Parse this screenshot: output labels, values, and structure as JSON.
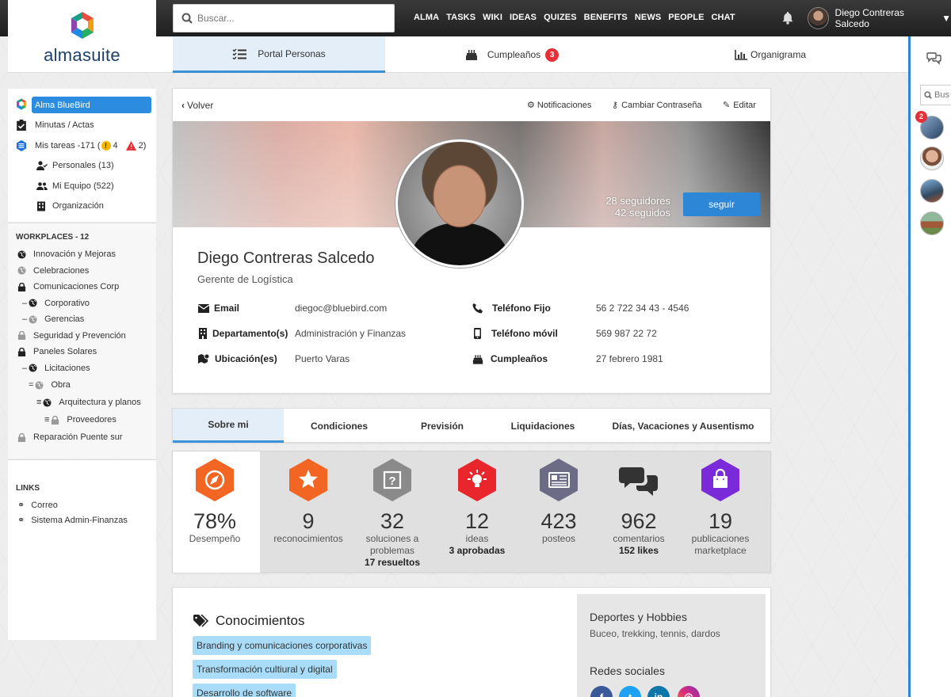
{
  "brand": {
    "logo_text": "almasuite"
  },
  "search": {
    "placeholder": "Buscar..."
  },
  "topnav": [
    "ALMA",
    "TASKS",
    "WIKI",
    "IDEAS",
    "QUIZES",
    "BENEFITS",
    "NEWS",
    "PEOPLE",
    "CHAT"
  ],
  "user": {
    "name": "Diego Contreras Salcedo"
  },
  "subnav": {
    "portal": "Portal Personas",
    "birthdays": "Cumpleaños",
    "birthdays_count": "3",
    "org": "Organigrama"
  },
  "rightbar": {
    "search_placeholder": "Bus",
    "avatar_badge": "2"
  },
  "sidebar": {
    "items": [
      {
        "label": "Alma BlueBird",
        "icon": "alma-logo-icon"
      },
      {
        "label": "Minutas / Actas",
        "icon": "clipboard-check-icon"
      },
      {
        "label_prefix": "Mis tareas -171 (",
        "warn_count": "4",
        "alert_count": "2)",
        "icon": "tasks-icon"
      },
      {
        "label": "Personales (13)",
        "icon": "user-check-icon"
      },
      {
        "label": "Mi Equipo (522)",
        "icon": "users-icon"
      },
      {
        "label": "Organización",
        "icon": "building-icon"
      }
    ],
    "workplaces_title": "WORKPLACES - 12",
    "workplaces": [
      {
        "label": "Innovación y Mejoras",
        "prefix": "",
        "icon": "globe-icon"
      },
      {
        "label": "Celebraciones",
        "prefix": "",
        "icon": "globe-gray-icon"
      },
      {
        "label": "Comunicaciones Corp",
        "prefix": "",
        "icon": "lock-icon"
      },
      {
        "label": "Corporativo",
        "prefix": "–",
        "icon": "globe-icon"
      },
      {
        "label": "Gerencias",
        "prefix": "–",
        "icon": "globe-gray-icon"
      },
      {
        "label": "Seguridad y Prevención",
        "prefix": "",
        "icon": "lock-gray-icon"
      },
      {
        "label": "Paneles Solares",
        "prefix": "",
        "icon": "lock-icon"
      },
      {
        "label": "Licitaciones",
        "prefix": "–",
        "icon": "globe-icon"
      },
      {
        "label": "Obra",
        "prefix": "=",
        "icon": "globe-gray-icon"
      },
      {
        "label": "Arquitectura y planos",
        "prefix": "≡",
        "icon": "globe-icon"
      },
      {
        "label": "Proveedores",
        "prefix": "≡",
        "icon": "lock-gray-icon"
      },
      {
        "label": "Reparación Puente sur",
        "prefix": "",
        "icon": "lock-gray-icon"
      }
    ],
    "links_title": "LINKS",
    "links": [
      "Correo",
      "Sistema Admin-Finanzas"
    ]
  },
  "profile": {
    "back": "Volver",
    "notifications": "Notificaciones",
    "change_password": "Cambiar Contraseña",
    "edit": "Editar",
    "followers": "28 seguidores",
    "following": "42 seguidos",
    "follow_button": "seguir",
    "name": "Diego Contreras Salcedo",
    "role": "Gerente de Logística",
    "fields": [
      {
        "label": "Email",
        "value": "diegoc@bluebird.com",
        "icon": "envelope-icon"
      },
      {
        "label": "Departamento(s)",
        "value": "Administración y Finanzas",
        "icon": "building-icon"
      },
      {
        "label": "Ubicación(es)",
        "value": "Puerto Varas",
        "icon": "map-icon"
      },
      {
        "label": "Teléfono Fijo",
        "value": "56 2 722 34 43 - 4546",
        "icon": "phone-icon"
      },
      {
        "label": "Teléfono móvil",
        "value": "569 987 22 72",
        "icon": "mobile-icon"
      },
      {
        "label": "Cumpleaños",
        "value": "27 febrero 1981",
        "icon": "cake-icon"
      }
    ]
  },
  "tabs": [
    "Sobre mi",
    "Condiciones",
    "Previsión",
    "Liquidaciones",
    "Días, Vacaciones y Ausentismo"
  ],
  "stats": [
    {
      "num": "78%",
      "lbl": "Desempeño",
      "lbl2": "",
      "sub": "",
      "color": "#f26522",
      "icon": "compass-icon"
    },
    {
      "num": "9",
      "lbl": "reconocimientos",
      "lbl2": "",
      "sub": "",
      "color": "#f26522",
      "icon": "star-icon"
    },
    {
      "num": "32",
      "lbl": "soluciones a",
      "lbl2": "problemas",
      "sub": "17 resueltos",
      "color": "#8a8a8a",
      "icon": "question-icon"
    },
    {
      "num": "12",
      "lbl": "ideas",
      "lbl2": "",
      "sub": "3 aprobadas",
      "color": "#e8262b",
      "icon": "lightbulb-icon"
    },
    {
      "num": "423",
      "lbl": "posteos",
      "lbl2": "",
      "sub": "",
      "color": "#6c6c86",
      "icon": "newspaper-icon"
    },
    {
      "num": "962",
      "lbl": "comentarios",
      "lbl2": "",
      "sub": "152 likes",
      "color": "#333333",
      "icon": "comments-icon"
    },
    {
      "num": "19",
      "lbl": "publicaciones",
      "lbl2": "marketplace",
      "sub": "",
      "color": "#7b2ad9",
      "icon": "shopping-bag-icon"
    }
  ],
  "knowledge": {
    "title": "Conocimientos",
    "chips": [
      "Branding y comunicaciones corporativas",
      "Transformación cultiural y digital",
      "Desarrollo de software"
    ]
  },
  "hobbies": {
    "title": "Deportes y Hobbies",
    "value": "Buceo, trekking, tennis, dardos",
    "social_title": "Redes sociales"
  },
  "colors": {
    "accent": "#2e86d6",
    "badge": "#e62f36",
    "chip": "#a8dcf8"
  }
}
